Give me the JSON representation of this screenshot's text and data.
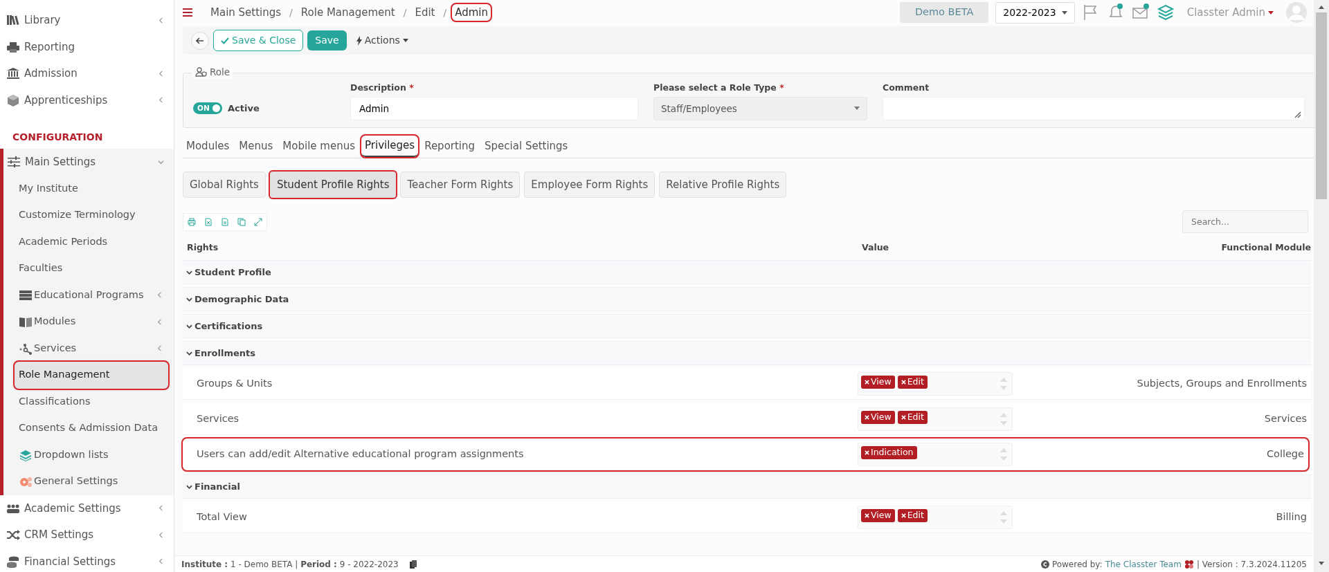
{
  "header": {
    "breadcrumb": [
      {
        "label": "Main Settings",
        "highlighted": false
      },
      {
        "label": "Role Management",
        "highlighted": false
      },
      {
        "label": "Edit",
        "highlighted": false
      },
      {
        "label": "Admin",
        "highlighted": true
      }
    ],
    "breadcrumb_separator": "/",
    "institute_button": "Demo BETA",
    "year_select": "2022-2023",
    "user_name": "Classter Admin"
  },
  "sidebar": {
    "top_items": [
      {
        "label": "Library",
        "expanded": false
      },
      {
        "label": "Reporting"
      },
      {
        "label": "Admission",
        "expanded": false
      },
      {
        "label": "Apprenticeships",
        "expanded": false
      }
    ],
    "section_title": "CONFIGURATION",
    "section_items": [
      {
        "label": "Main Settings",
        "expanded": true,
        "children": [
          {
            "label": "My Institute",
            "selected": false,
            "highlighted": false
          },
          {
            "label": "Customize Terminology",
            "selected": false,
            "highlighted": false
          },
          {
            "label": "Academic Periods",
            "selected": false,
            "highlighted": false
          },
          {
            "label": "Faculties",
            "selected": false,
            "highlighted": false
          },
          {
            "label": "Educational Programs",
            "expanded": false,
            "selected": false,
            "highlighted": false
          },
          {
            "label": "Modules",
            "expanded": false,
            "selected": false,
            "highlighted": false
          },
          {
            "label": "Services",
            "expanded": false,
            "selected": false,
            "highlighted": false
          },
          {
            "label": "Role Management",
            "selected": true,
            "highlighted": true
          },
          {
            "label": "Classifications",
            "selected": false,
            "highlighted": false
          },
          {
            "label": "Consents & Admission Data",
            "selected": false,
            "highlighted": false
          },
          {
            "label": "Dropdown lists",
            "selected": false,
            "highlighted": false
          },
          {
            "label": "General Settings",
            "selected": false,
            "highlighted": false
          }
        ]
      },
      {
        "label": "Academic Settings",
        "expanded": false
      },
      {
        "label": "CRM Settings",
        "expanded": false
      },
      {
        "label": "Financial Settings",
        "expanded": false
      }
    ]
  },
  "toolbar": {
    "save_close": "Save & Close",
    "save": "Save",
    "actions": "Actions"
  },
  "role": {
    "legend": "Role",
    "required_mark": "*",
    "active": {
      "on": true,
      "switch_text": "ON",
      "label": "Active"
    },
    "description": {
      "label": "Description",
      "required": true,
      "value": "Admin"
    },
    "role_type": {
      "label": "Please select a Role Type",
      "required": true,
      "value": "Staff/Employees"
    },
    "comment": {
      "label": "Comment"
    }
  },
  "tabs": [
    {
      "label": "Modules",
      "selected": false,
      "highlighted": false
    },
    {
      "label": "Menus",
      "selected": false,
      "highlighted": false
    },
    {
      "label": "Mobile menus",
      "selected": false,
      "highlighted": false
    },
    {
      "label": "Privileges",
      "selected": true,
      "highlighted": true
    },
    {
      "label": "Reporting",
      "selected": false,
      "highlighted": false
    },
    {
      "label": "Special Settings",
      "selected": false,
      "highlighted": false
    }
  ],
  "subtabs": [
    {
      "label": "Global Rights",
      "selected": false,
      "highlighted": false
    },
    {
      "label": "Student Profile Rights",
      "selected": true,
      "highlighted": true
    },
    {
      "label": "Teacher Form Rights",
      "selected": false,
      "highlighted": false
    },
    {
      "label": "Employee Form Rights",
      "selected": false,
      "highlighted": false
    },
    {
      "label": "Relative Profile Rights",
      "selected": false,
      "highlighted": false
    }
  ],
  "table": {
    "search_placeholder": "Search...",
    "columns": [
      "Rights",
      "Value",
      "Functional Module"
    ],
    "groups": [
      {
        "title": "Student Profile",
        "expanded": true
      },
      {
        "title": "Demographic Data",
        "expanded": true
      },
      {
        "title": "Certifications",
        "expanded": true
      },
      {
        "title": "Enrollments",
        "expanded": true,
        "rows": [
          {
            "right": "Groups & Units",
            "values": [
              "View",
              "Edit"
            ],
            "module": "Subjects, Groups and Enrollments",
            "highlighted": false
          },
          {
            "right": "Services",
            "values": [
              "View",
              "Edit"
            ],
            "module": "Services",
            "highlighted": false
          },
          {
            "right": "Users can add/edit Alternative educational program assignments",
            "values": [
              "Indication"
            ],
            "module": "College",
            "highlighted": true
          }
        ]
      },
      {
        "title": "Financial",
        "expanded": true,
        "rows": [
          {
            "right": "Total View",
            "values": [
              "View",
              "Edit"
            ],
            "module": "Billing",
            "highlighted": false
          }
        ]
      }
    ]
  },
  "footer": {
    "left": "**Institute :** 1 - Demo BETA | **Period :** 9 - 2022-2023",
    "powered_by": "Powered by:",
    "team_link": "The Classter Team",
    "version": "| Version : 7.3.2024.11205"
  }
}
